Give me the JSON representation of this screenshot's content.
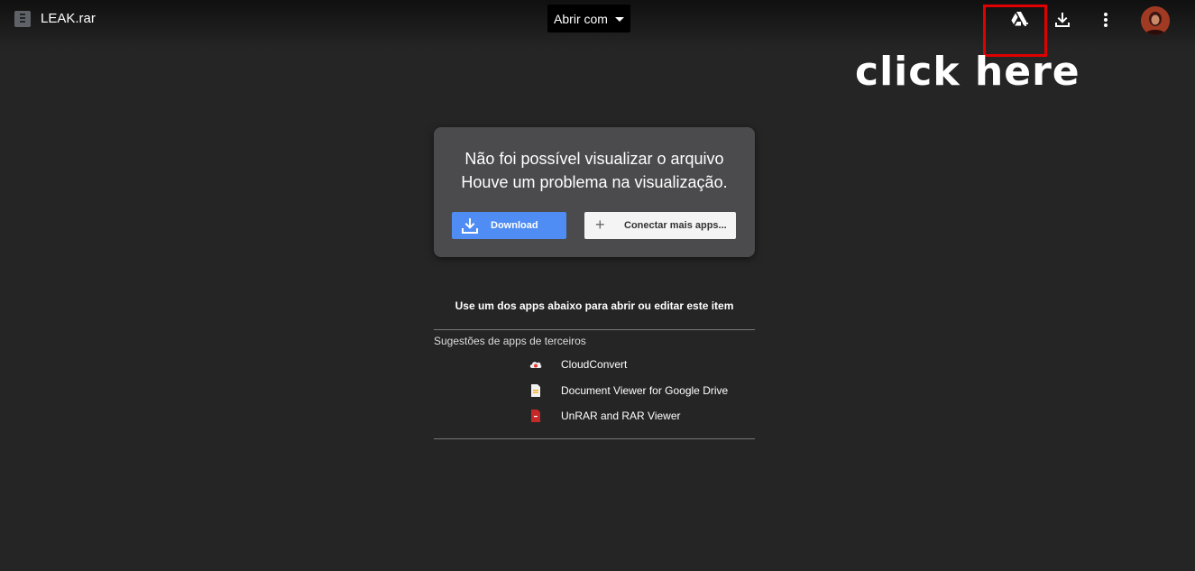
{
  "header": {
    "file_name": "LEAK.rar",
    "open_with_label": "Abrir com"
  },
  "annotation": {
    "text": "click here",
    "color": "#e00000"
  },
  "error_card": {
    "line1": "Não foi possível visualizar o arquivo",
    "line2": "Houve um problema na visualização.",
    "download_label": "Download",
    "connect_label": "Conectar mais apps..."
  },
  "apps": {
    "heading": "Use um dos apps abaixo para abrir ou editar este item",
    "suggest_label": "Sugestões de apps de terceiros",
    "items": [
      {
        "name": "CloudConvert",
        "icon": "cloudconvert-icon"
      },
      {
        "name": "Document Viewer for Google Drive",
        "icon": "document-viewer-icon"
      },
      {
        "name": "UnRAR and RAR Viewer",
        "icon": "unrar-icon"
      }
    ]
  },
  "colors": {
    "background": "#252525",
    "primary_button": "#4f8cf3",
    "card": "#4b4a4c"
  }
}
